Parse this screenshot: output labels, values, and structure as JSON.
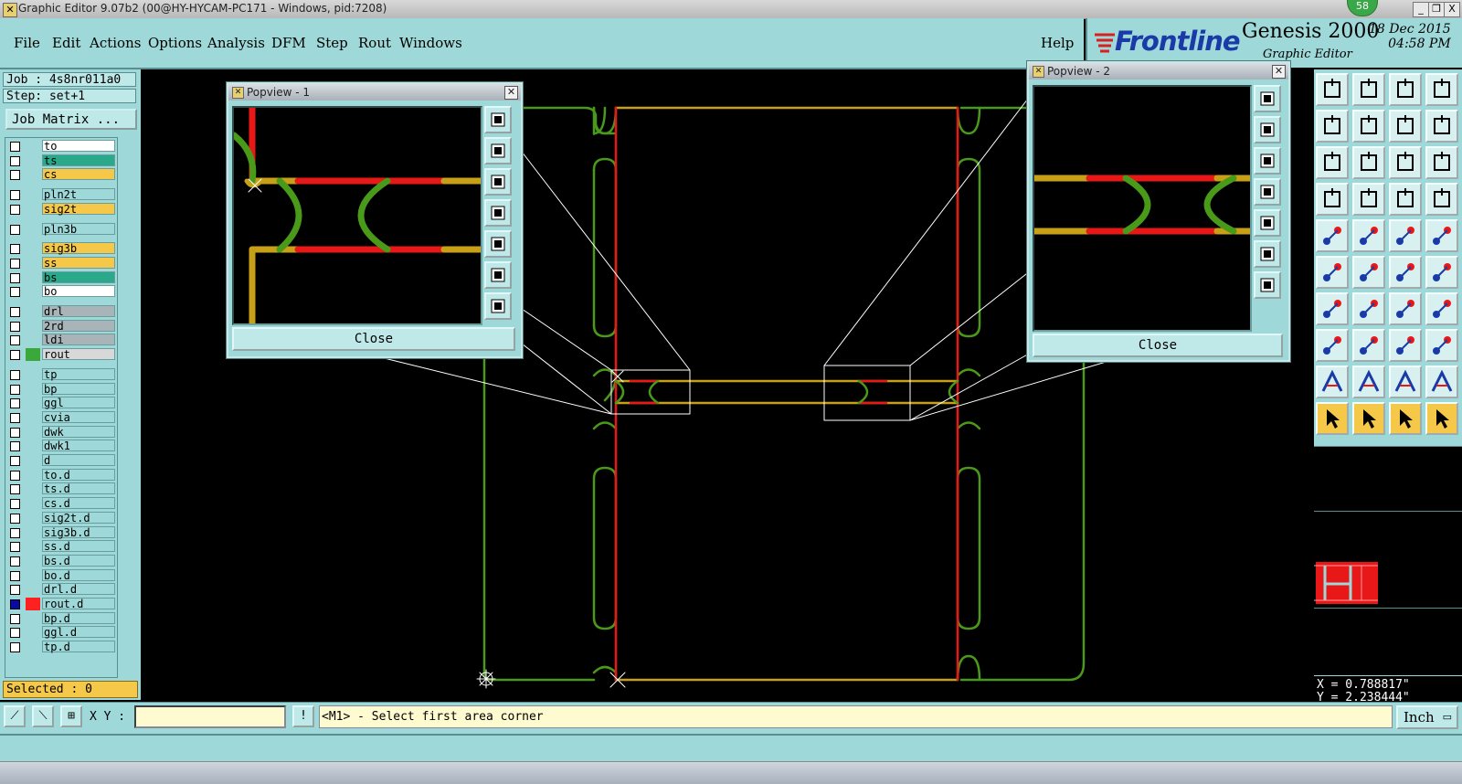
{
  "window": {
    "title": "Graphic Editor 9.07b2 (00@HY-HYCAM-PC171 - Windows, pid:7208)",
    "badge_count": "58",
    "controls": [
      "_",
      "❐",
      "X"
    ]
  },
  "menu": {
    "items": [
      "File",
      "Edit",
      "Actions",
      "Options",
      "Analysis",
      "DFM",
      "Step",
      "Rout",
      "Windows"
    ],
    "help": "Help"
  },
  "brand": {
    "logo": "Frontline",
    "product": "Genesis 2000",
    "subtitle": "Graphic Editor",
    "date": "18 Dec 2015",
    "time": "04:58 PM"
  },
  "job": {
    "job_line": "Job : 4s8nr011a0",
    "step_line": "Step: set+1",
    "matrix_button": "Job Matrix ...",
    "selected": "Selected : 0"
  },
  "layers": [
    {
      "name": "to",
      "color": "#ffffff",
      "swatch": ""
    },
    {
      "name": "ts",
      "color": "#2aa88a",
      "swatch": ""
    },
    {
      "name": "cs",
      "color": "#f5c84a",
      "swatch": ""
    },
    {
      "name": "pln2t",
      "color": "#9ed8d8",
      "swatch": ""
    },
    {
      "name": "sig2t",
      "color": "#f5c84a",
      "swatch": ""
    },
    {
      "name": "pln3b",
      "color": "#9ed8d8",
      "swatch": ""
    },
    {
      "name": "sig3b",
      "color": "#f5c84a",
      "swatch": ""
    },
    {
      "name": "ss",
      "color": "#f5c84a",
      "swatch": ""
    },
    {
      "name": "bs",
      "color": "#2aa88a",
      "swatch": ""
    },
    {
      "name": "bo",
      "color": "#ffffff",
      "swatch": ""
    },
    {
      "name": "drl",
      "color": "#a8b4b8",
      "swatch": ""
    },
    {
      "name": "2rd",
      "color": "#a8b4b8",
      "swatch": ""
    },
    {
      "name": "ldi",
      "color": "#a8b4b8",
      "swatch": ""
    },
    {
      "name": "rout",
      "color": "#d8d8d8",
      "swatch": "#3aa83a"
    },
    {
      "name": "tp",
      "color": "#9ed8d8",
      "swatch": ""
    },
    {
      "name": "bp",
      "color": "#9ed8d8",
      "swatch": ""
    },
    {
      "name": "ggl",
      "color": "#9ed8d8",
      "swatch": ""
    },
    {
      "name": "cvia",
      "color": "#9ed8d8",
      "swatch": ""
    },
    {
      "name": "dwk",
      "color": "#9ed8d8",
      "swatch": ""
    },
    {
      "name": "dwk1",
      "color": "#9ed8d8",
      "swatch": ""
    },
    {
      "name": "d",
      "color": "#9ed8d8",
      "swatch": ""
    },
    {
      "name": "to.d",
      "color": "#9ed8d8",
      "swatch": ""
    },
    {
      "name": "ts.d",
      "color": "#9ed8d8",
      "swatch": ""
    },
    {
      "name": "cs.d",
      "color": "#9ed8d8",
      "swatch": ""
    },
    {
      "name": "sig2t.d",
      "color": "#9ed8d8",
      "swatch": ""
    },
    {
      "name": "sig3b.d",
      "color": "#9ed8d8",
      "swatch": ""
    },
    {
      "name": "ss.d",
      "color": "#9ed8d8",
      "swatch": ""
    },
    {
      "name": "bs.d",
      "color": "#9ed8d8",
      "swatch": ""
    },
    {
      "name": "bo.d",
      "color": "#9ed8d8",
      "swatch": ""
    },
    {
      "name": "drl.d",
      "color": "#9ed8d8",
      "swatch": ""
    },
    {
      "name": "rout.d",
      "color": "#9ed8d8",
      "swatch": "#ff2020"
    },
    {
      "name": "bp.d",
      "color": "#9ed8d8",
      "swatch": ""
    },
    {
      "name": "ggl.d",
      "color": "#9ed8d8",
      "swatch": ""
    },
    {
      "name": "tp.d",
      "color": "#9ed8d8",
      "swatch": ""
    }
  ],
  "popview1": {
    "title": "Popview - 1",
    "close": "Close"
  },
  "popview2": {
    "title": "Popview - 2",
    "close": "Close"
  },
  "commandbar": {
    "xy_label": "X Y :",
    "xy_value": "",
    "alert_icon": "!",
    "prompt": "<M1> - Select first area corner",
    "units": "Inch"
  },
  "coords": {
    "x": "X = 0.788817\"",
    "y": "Y = 2.238444\""
  },
  "colors": {
    "panel": "#9ed8d8",
    "rout_green": "#4a9a1a",
    "trace_gold": "#c8a018",
    "trace_red": "#e81818"
  }
}
